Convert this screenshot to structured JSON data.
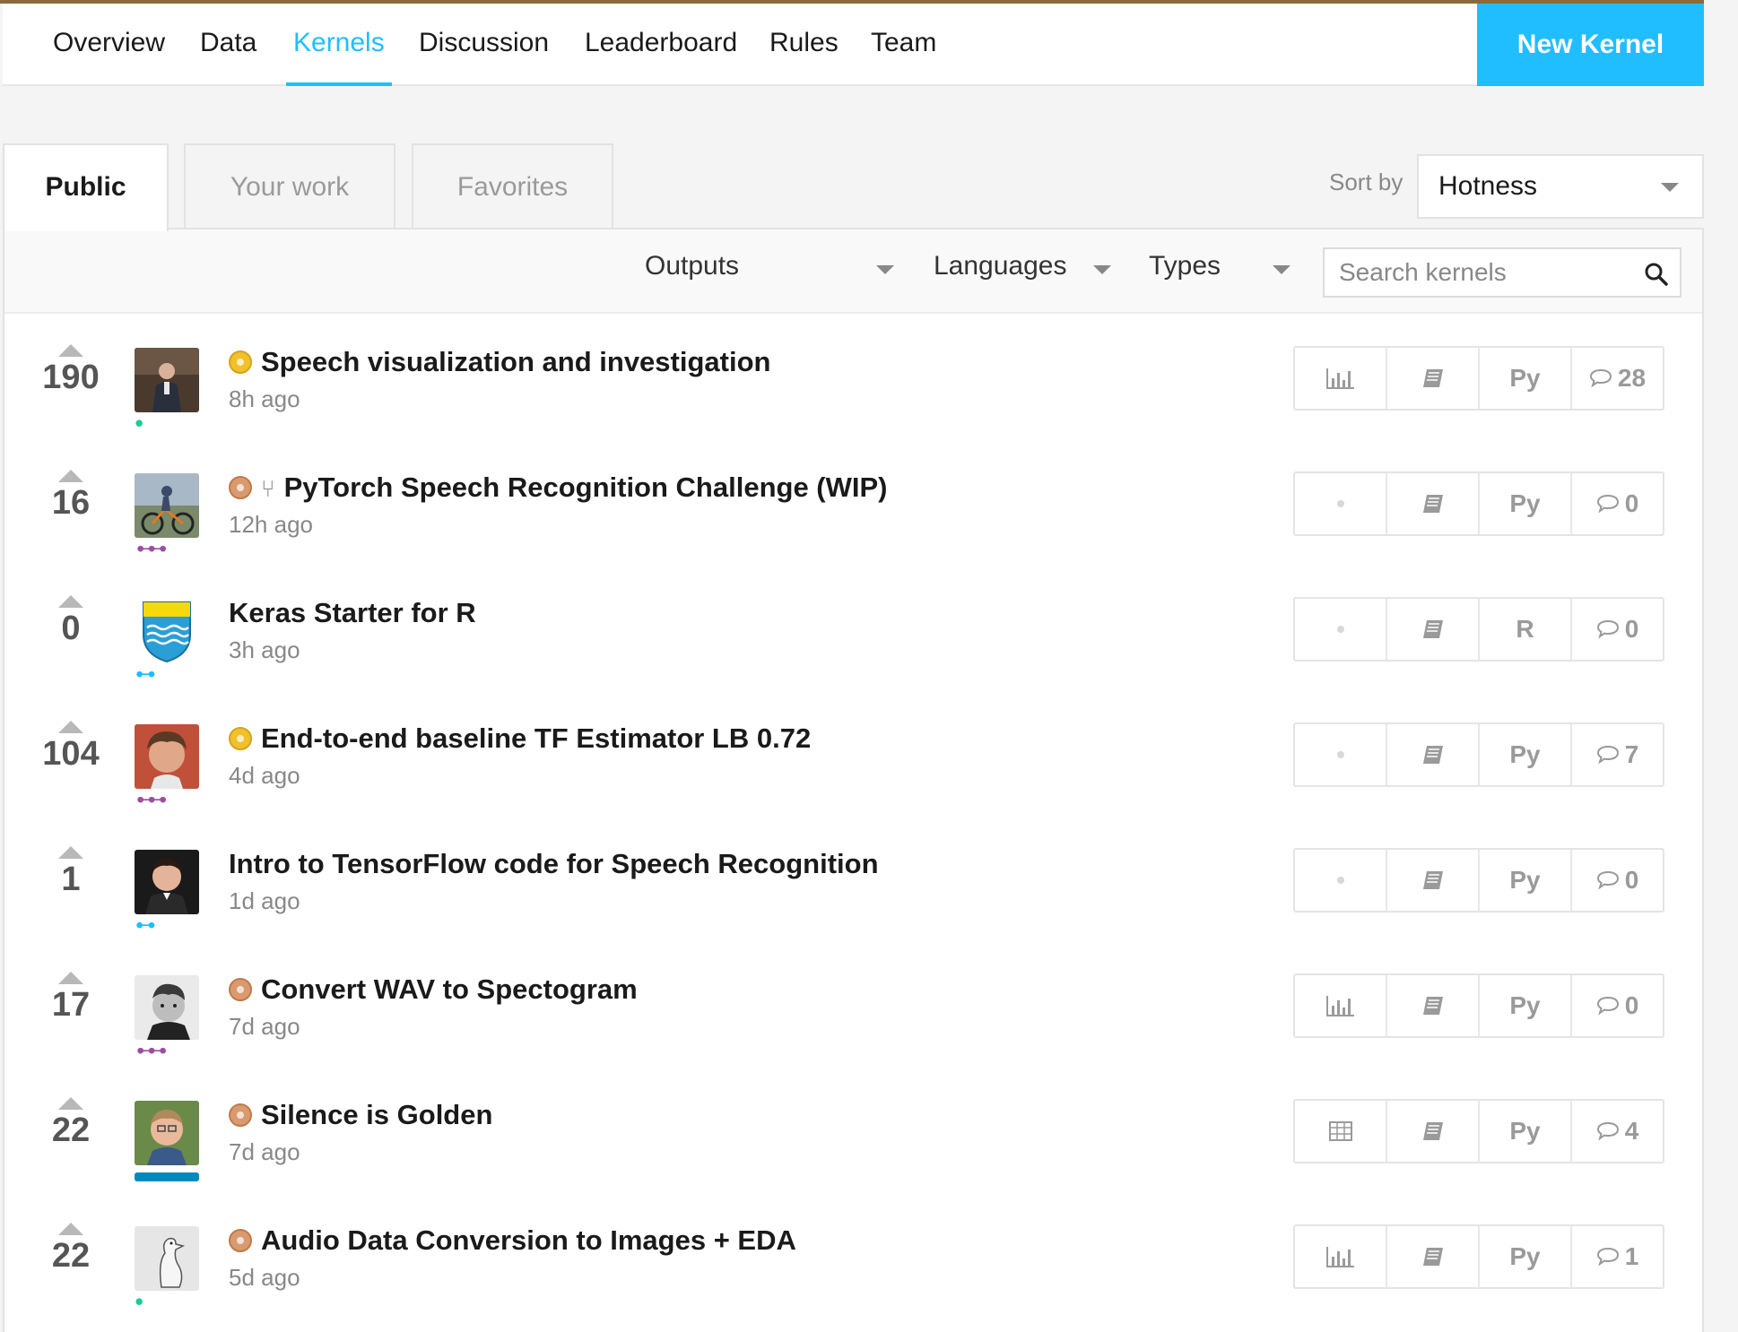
{
  "nav": {
    "items": [
      {
        "label": "Overview"
      },
      {
        "label": "Data"
      },
      {
        "label": "Kernels"
      },
      {
        "label": "Discussion"
      },
      {
        "label": "Leaderboard"
      },
      {
        "label": "Rules"
      },
      {
        "label": "Team"
      }
    ],
    "active": "Kernels",
    "new_kernel_label": "New Kernel"
  },
  "tabs": [
    {
      "label": "Public"
    },
    {
      "label": "Your work"
    },
    {
      "label": "Favorites"
    }
  ],
  "sort": {
    "label": "Sort by",
    "value": "Hotness"
  },
  "filters": {
    "outputs": "Outputs",
    "languages": "Languages",
    "types": "Types",
    "search_placeholder": "Search kernels"
  },
  "colors": {
    "accent": "#20beff",
    "gold": "#f0c12a",
    "bronze": "#d99a70"
  },
  "kernels": [
    {
      "votes": "190",
      "medal": "gold",
      "title": "Speech visualization and investigation",
      "time": "8h ago",
      "output": "chart-icon",
      "language": "Py",
      "comments": "28"
    },
    {
      "votes": "16",
      "medal": "bronze",
      "forked": true,
      "title": "PyTorch Speech Recognition Challenge (WIP)",
      "time": "12h ago",
      "output": "none",
      "language": "Py",
      "comments": "0"
    },
    {
      "votes": "0",
      "medal": "none",
      "title": "Keras Starter for R",
      "time": "3h ago",
      "output": "none",
      "language": "R",
      "comments": "0"
    },
    {
      "votes": "104",
      "medal": "gold",
      "title": "End-to-end baseline TF Estimator LB 0.72",
      "time": "4d ago",
      "output": "none",
      "language": "Py",
      "comments": "7"
    },
    {
      "votes": "1",
      "medal": "none",
      "title": "Intro to TensorFlow code for Speech Recognition",
      "time": "1d ago",
      "output": "none",
      "language": "Py",
      "comments": "0"
    },
    {
      "votes": "17",
      "medal": "bronze",
      "title": "Convert WAV to Spectogram",
      "time": "7d ago",
      "output": "chart-icon",
      "language": "Py",
      "comments": "0"
    },
    {
      "votes": "22",
      "medal": "bronze",
      "title": "Silence is Golden",
      "time": "7d ago",
      "output": "table-icon",
      "language": "Py",
      "comments": "4"
    },
    {
      "votes": "22",
      "medal": "bronze",
      "title": "Audio Data Conversion to Images + EDA",
      "time": "5d ago",
      "output": "chart-icon",
      "language": "Py",
      "comments": "1"
    }
  ]
}
